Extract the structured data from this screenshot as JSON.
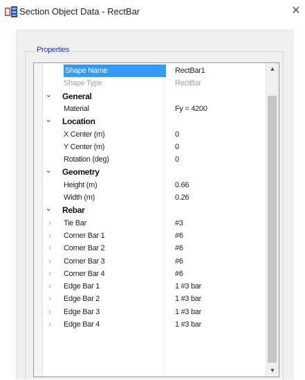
{
  "window": {
    "title": "Section Object Data - RectBar",
    "close_glyph": "✕"
  },
  "properties_legend": "Properties",
  "rows": [
    {
      "kind": "prop",
      "label": "Shape Name",
      "value": "RectBar1",
      "selected": true
    },
    {
      "kind": "prop",
      "label": "Shape Type",
      "value": "RectBar",
      "disabled": true
    },
    {
      "kind": "cat",
      "label": "General"
    },
    {
      "kind": "prop",
      "label": "Material",
      "value": "Fy = 4200"
    },
    {
      "kind": "cat",
      "label": "Location"
    },
    {
      "kind": "prop",
      "label": "X Center (m)",
      "value": "0"
    },
    {
      "kind": "prop",
      "label": "Y Center (m)",
      "value": "0"
    },
    {
      "kind": "prop",
      "label": "Rotation (deg)",
      "value": "0"
    },
    {
      "kind": "cat",
      "label": "Geometry"
    },
    {
      "kind": "prop",
      "label": "Height (m)",
      "value": "0.66"
    },
    {
      "kind": "prop",
      "label": "Width (m)",
      "value": "0.26"
    },
    {
      "kind": "cat",
      "label": "Rebar"
    },
    {
      "kind": "sub",
      "label": "Tie Bar",
      "value": "#3"
    },
    {
      "kind": "sub",
      "label": "Corner Bar 1",
      "value": "#6"
    },
    {
      "kind": "sub",
      "label": "Corner Bar 2",
      "value": "#6"
    },
    {
      "kind": "sub",
      "label": "Corner Bar 3",
      "value": "#6"
    },
    {
      "kind": "sub",
      "label": "Corner Bar 4",
      "value": "#6"
    },
    {
      "kind": "sub",
      "label": "Edge Bar 1",
      "value": "1 #3 bar"
    },
    {
      "kind": "sub",
      "label": "Edge Bar 2",
      "value": "1 #3 bar"
    },
    {
      "kind": "sub",
      "label": "Edge Bar 3",
      "value": "1 #3 bar"
    },
    {
      "kind": "sub",
      "label": "Edge Bar 4",
      "value": "1 #3 bar"
    }
  ],
  "icons": {
    "collapse": "chevron-down-icon",
    "expand": "chevron-right-icon",
    "scroll_up": "scroll-up-arrow-icon",
    "scroll_down": "scroll-down-arrow-icon"
  },
  "colors": {
    "selection": "#3399ff",
    "legend_text": "#1b3da0",
    "disabled_text": "#a0a0a0"
  }
}
